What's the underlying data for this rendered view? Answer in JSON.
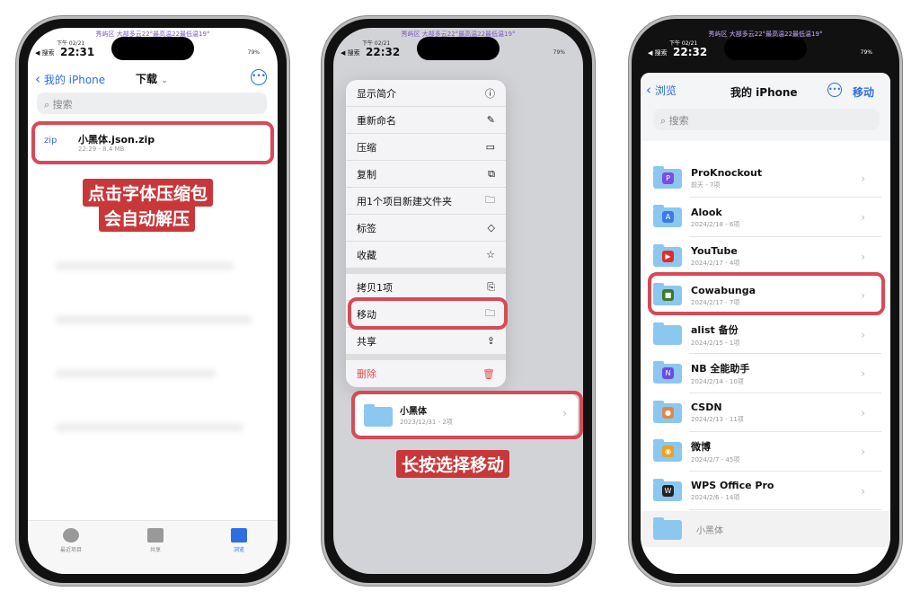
{
  "status": {
    "weather": "秀屿区 大部多云22°最高温22最低温19°",
    "date": "下午 02/21",
    "back": "◀ 搜索",
    "battery": "79%"
  },
  "phone1": {
    "time": "22:31",
    "nav_back": "我的 iPhone",
    "title": "下载",
    "search_placeholder": "搜索",
    "file": {
      "icon": "zip",
      "name": "小黑体.json.zip",
      "meta": "22:29 - 8.4 MB"
    },
    "caption_lines": [
      "点击字体压缩包",
      "会自动解压"
    ],
    "tabs": [
      {
        "label": "最近项目"
      },
      {
        "label": "共享"
      },
      {
        "label": "浏览"
      }
    ]
  },
  "phone2": {
    "time": "22:32",
    "menu_group1": [
      {
        "label": "显示简介",
        "icon": "ⓘ"
      },
      {
        "label": "重新命名",
        "icon": "✎"
      },
      {
        "label": "压缩",
        "icon": "▭"
      },
      {
        "label": "复制",
        "icon": "⧉"
      },
      {
        "label": "用1个项目新建文件夹",
        "icon": "🗀"
      },
      {
        "label": "标签",
        "icon": "◇"
      },
      {
        "label": "收藏",
        "icon": "☆"
      }
    ],
    "menu_group2": [
      {
        "label": "拷贝1项",
        "icon": "⎘"
      },
      {
        "label": "移动",
        "icon": "🗀"
      },
      {
        "label": "共享",
        "icon": "⇪"
      }
    ],
    "delete": {
      "label": "删除",
      "icon": "🗑"
    },
    "folder": {
      "name": "小黑体",
      "meta": "2023/12/31 - 2项"
    },
    "caption": "长按选择移动"
  },
  "phone3": {
    "time": "22:32",
    "nav_back": "浏览",
    "title": "我的 iPhone",
    "action": "移动",
    "search_placeholder": "搜索",
    "folders": [
      {
        "name": "ProKnockout",
        "meta": "前天 - 7项",
        "color": "#7b4de0",
        "glyph": "P"
      },
      {
        "name": "Alook",
        "meta": "2024/2/18 - 6项",
        "color": "#3b7be8",
        "glyph": "A"
      },
      {
        "name": "YouTube",
        "meta": "2024/2/17 - 4项",
        "color": "#e02b2b",
        "glyph": "▶"
      },
      {
        "name": "Cowabunga",
        "meta": "2024/2/17 - 7项",
        "color": "#3c7a2a",
        "glyph": "■"
      },
      {
        "name": "alist 备份",
        "meta": "2024/2/15 - 1项",
        "color": "",
        "glyph": ""
      },
      {
        "name": "NB 全能助手",
        "meta": "2024/2/14 - 10项",
        "color": "#6b4de6",
        "glyph": "N"
      },
      {
        "name": "CSDN",
        "meta": "2024/2/13 - 11项",
        "color": "#e0884a",
        "glyph": "●"
      },
      {
        "name": "微博",
        "meta": "2024/2/7 - 45项",
        "color": "#f0a020",
        "glyph": "◉"
      },
      {
        "name": "WPS Office Pro",
        "meta": "2024/2/6 - 14项",
        "color": "#222",
        "glyph": "W"
      }
    ],
    "moving_item": "小黑体"
  },
  "colors": {
    "accent": "#2d6fe0",
    "highlight": "#d74a57",
    "caption_bg": "#c8383a",
    "destructive": "#e05050"
  }
}
